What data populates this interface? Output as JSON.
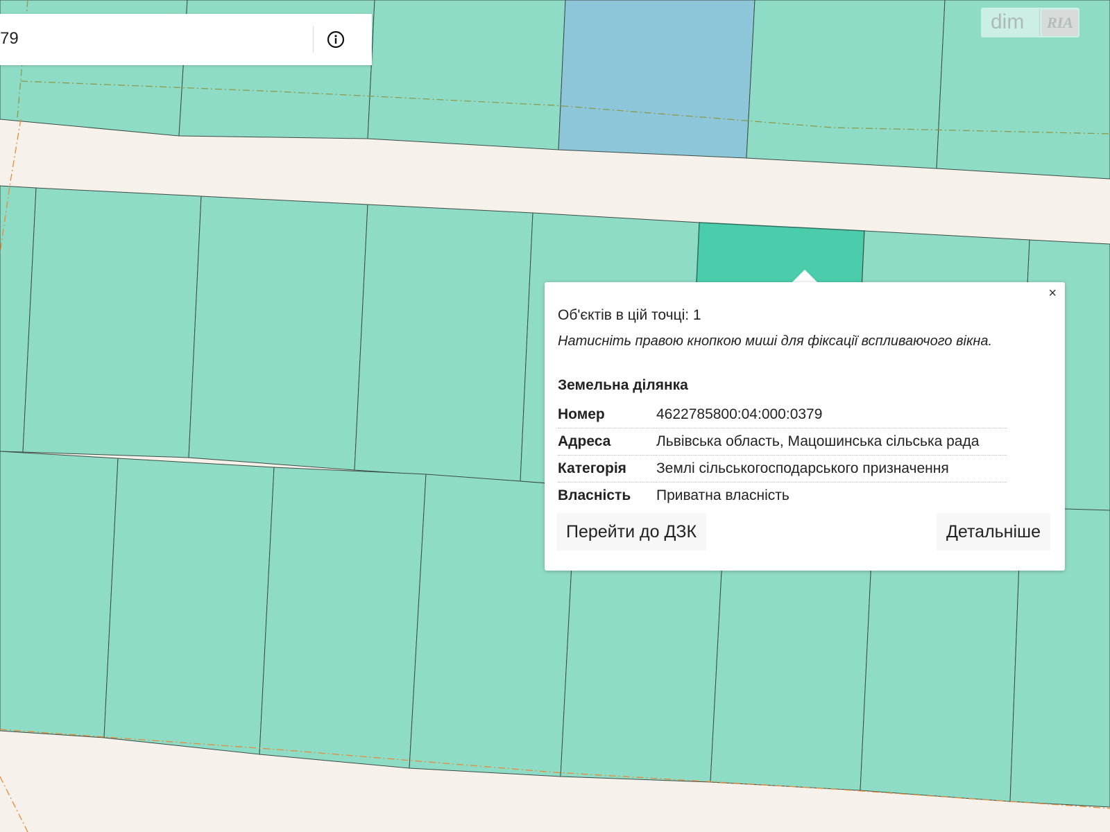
{
  "search": {
    "value": "79"
  },
  "icons": {
    "info": "info-circle-icon",
    "close": "close-icon"
  },
  "logo": {
    "text_dim": "dim",
    "text_ria": "RIA"
  },
  "colors": {
    "parcel": "#8fdcc6",
    "parcel_selected": "#4bcdac",
    "parcel_other": "#8cc6d8",
    "road": "#f6f1ea",
    "boundary": "#e58a3a"
  },
  "popup": {
    "close_label": "×",
    "count_line": "Об'єктів в цій точці: 1",
    "hint": "Натисніть правою кнопкою миші для фіксації вспливаючого вікна.",
    "section_title": "Земельна ділянка",
    "attributes": [
      {
        "key": "Номер",
        "value": "4622785800:04:000:0379"
      },
      {
        "key": "Адреса",
        "value": "Львівська область, Мацошинська сільська рада"
      },
      {
        "key": "Категорія",
        "value": "Землі сільськогосподарського призначення"
      },
      {
        "key": "Власність",
        "value": "Приватна власність"
      }
    ],
    "buttons": {
      "go_dzk": "Перейти до ДЗК",
      "details": "Детальніше"
    }
  }
}
